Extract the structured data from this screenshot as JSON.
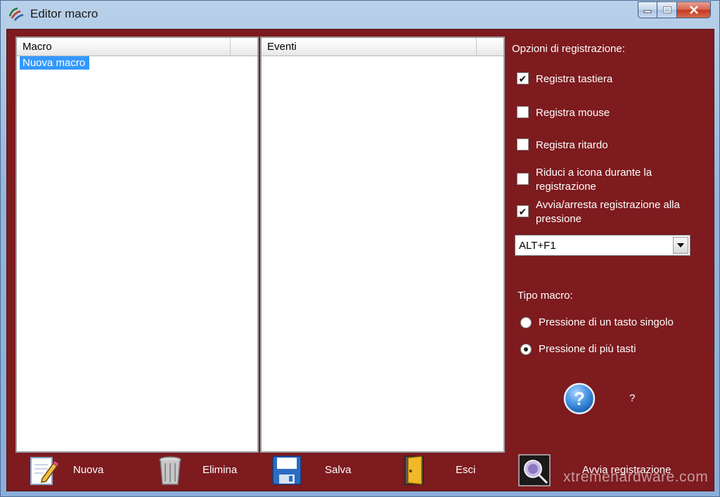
{
  "window": {
    "title": "Editor macro",
    "accent": "#7d1b1f"
  },
  "macro_list": {
    "header": "Macro",
    "items": [
      "Nuova macro"
    ],
    "selected_index": 0
  },
  "events_list": {
    "header": "Eventi",
    "items": []
  },
  "options": {
    "title": "Opzioni di registrazione:",
    "checkboxes": [
      {
        "label": "Registra tastiera",
        "checked": true
      },
      {
        "label": "Registra mouse",
        "checked": false
      },
      {
        "label": "Registra ritardo",
        "checked": false
      },
      {
        "label": "Riduci a icona durante la registrazione",
        "checked": false
      },
      {
        "label": "Avvia/arresta registrazione alla pressione",
        "checked": true
      }
    ],
    "hotkey_value": "ALT+F1"
  },
  "macro_type": {
    "title": "Tipo macro:",
    "options": [
      {
        "label": "Pressione di un tasto singolo",
        "selected": false
      },
      {
        "label": "Pressione di più tasti",
        "selected": true
      }
    ]
  },
  "help": {
    "icon": "help-icon",
    "label": "?"
  },
  "toolbar": {
    "new_label": "Nuova",
    "delete_label": "Elimina",
    "save_label": "Salva",
    "exit_label": "Esci",
    "record_label": "Avvia registrazione"
  },
  "watermark": "xtremehardware.com"
}
